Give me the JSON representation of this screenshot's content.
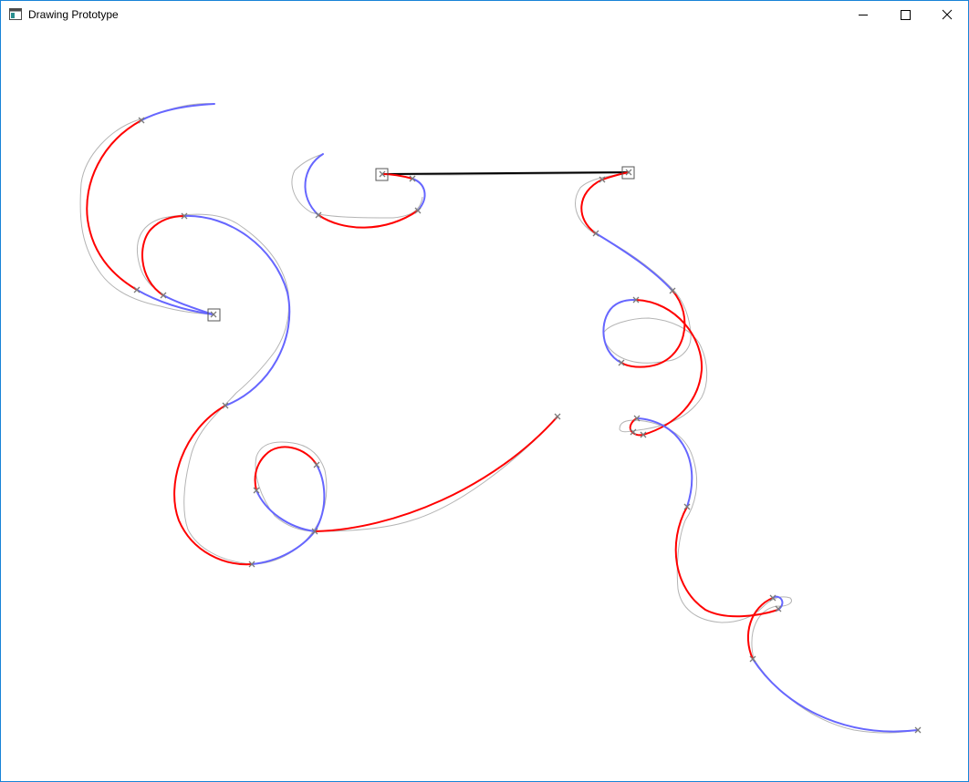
{
  "window": {
    "title": "Drawing Prototype",
    "border_color": "#1883d7"
  },
  "titlebar": {
    "app_icon": "app-window-icon",
    "minimize_icon": "minimize-icon",
    "maximize_icon": "maximize-icon",
    "close_icon": "close-icon"
  },
  "canvas": {
    "colors": {
      "fitted_curve_a": "#ff0000",
      "fitted_curve_b": "#6666ff",
      "raw_stroke": "#b4b4b4",
      "segment_marker": "#7a7a7a",
      "straight_line": "#000000"
    },
    "marker_icon": "x-marker-icon",
    "endpoint_handle_icon": "square-handle-icon"
  }
}
